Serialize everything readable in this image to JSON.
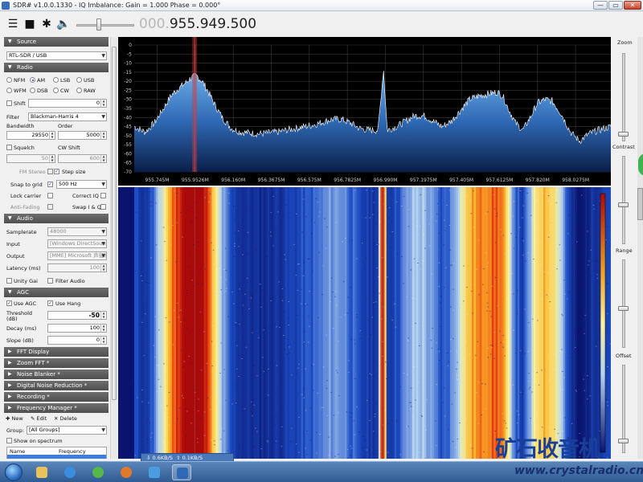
{
  "window": {
    "title": "SDR# v1.0.0.1330 - IQ Imbalance: Gain = 1.000 Phase = 0.000°",
    "minimize_label": "—",
    "maximize_label": "▭",
    "close_label": "✕"
  },
  "toolbar": {
    "menu_icon": "menu-icon",
    "stop_icon": "stop-icon",
    "settings_icon": "gear-icon",
    "volume_icon": "speaker-icon",
    "frequency_prefix": "000.",
    "frequency_value": "955.949.500"
  },
  "source": {
    "header": "Source",
    "device": "RTL-SDR / USB"
  },
  "radio": {
    "header": "Radio",
    "modes": [
      "NFM",
      "AM",
      "LSB",
      "USB",
      "WFM",
      "DSB",
      "CW",
      "RAW"
    ],
    "selected_mode": "AM",
    "shift_label": "Shift",
    "shift_value": "0",
    "filter_label": "Filter",
    "filter_value": "Blackman-Harris 4",
    "bandwidth_label": "Bandwidth",
    "bandwidth_value": "29550",
    "order_label": "Order",
    "order_value": "5000",
    "squelch_label": "Squelch",
    "squelch_value": "50",
    "cw_shift_label": "CW Shift",
    "cw_shift_value": "600",
    "fm_stereo_label": "FM Stereo",
    "step_size_label": "Step size",
    "snap_label": "Snap to grid",
    "step_value": "500 Hz",
    "lock_carrier_label": "Lock carrier",
    "correct_iq_label": "Correct IQ",
    "anti_fading_label": "Anti-Fading",
    "swap_iq_label": "Swap I & Q"
  },
  "audio": {
    "header": "Audio",
    "samplerate_label": "Samplerate",
    "samplerate_value": "48000",
    "input_label": "Input",
    "input_value": "[Windows DirectSound] ...",
    "output_label": "Output",
    "output_value": "[MME] Microsoft 声音映射器",
    "latency_label": "Latency (ms)",
    "latency_value": "100",
    "unity_gain_label": "Unity Gai",
    "filter_audio_label": "Filter Audio"
  },
  "agc": {
    "header": "AGC",
    "use_agc_label": "Use AGC",
    "use_hang_label": "Use Hang",
    "threshold_label": "Threshold",
    "threshold_unit": "(dB)",
    "threshold_value": "-50",
    "decay_label": "Decay (ms)",
    "decay_value": "100",
    "slope_label": "Slope (dB)",
    "slope_value": "0"
  },
  "collapsed_sections": [
    "FFT Display",
    "Zoom FFT *",
    "Noise Blanker *",
    "Digital Noise Reduction *",
    "Recording *",
    "Frequency Manager *"
  ],
  "frequency_manager": {
    "new_label": "New",
    "edit_label": "Edit",
    "delete_label": "Delete",
    "group_label": "Group:",
    "group_value": "[All Groups]",
    "show_spectrum_label": "Show on spectrum",
    "col_name": "Name",
    "col_frequency": "Frequency"
  },
  "right_panel": {
    "zoom_label": "Zoom",
    "contrast_label": "Contrast",
    "range_label": "Range",
    "offset_label": "Offset"
  },
  "network": {
    "down": "0.6KB/S",
    "up": "0.1KB/S"
  },
  "watermark": {
    "chinese": "矿石收音机",
    "url": "www.crystalradio.cn"
  },
  "chart_data": {
    "type": "area",
    "ylim": [
      -70,
      0
    ],
    "y_ticks": [
      0,
      -5,
      -10,
      -15,
      -20,
      -25,
      -30,
      -35,
      -40,
      -45,
      -50,
      -55,
      -60,
      -65,
      -70
    ],
    "x_tick_labels": [
      "955.745M",
      "955.9526M",
      "956.160M",
      "956.3675M",
      "956.575M",
      "956.7825M",
      "956.990M",
      "957.1975M",
      "957.405M",
      "957.6125M",
      "957.820M",
      "958.0275M"
    ],
    "x_ticks_mhz": [
      955.745,
      955.9526,
      956.16,
      956.3675,
      956.575,
      956.7825,
      956.99,
      957.1975,
      957.405,
      957.6125,
      957.82,
      958.0275
    ],
    "xlim": [
      955.62,
      958.22
    ],
    "tuned_mhz": 955.9495,
    "profile_x_mhz": [
      955.62,
      955.68,
      955.73,
      955.78,
      955.82,
      955.86,
      955.9,
      955.93,
      955.96,
      955.99,
      956.02,
      956.06,
      956.1,
      956.15,
      956.2,
      956.3,
      956.4,
      956.5,
      956.6,
      956.7,
      956.75,
      956.8,
      956.85,
      956.9,
      956.95,
      956.98,
      957.0,
      957.05,
      957.1,
      957.15,
      957.2,
      957.25,
      957.3,
      957.35,
      957.4,
      957.45,
      957.5,
      957.55,
      957.6,
      957.63,
      957.66,
      957.7,
      957.74,
      957.78,
      957.82,
      957.86,
      957.9,
      957.95,
      958.0,
      958.05,
      958.1,
      958.15,
      958.22
    ],
    "profile_y_db": [
      -45,
      -48,
      -43,
      -35,
      -28,
      -24,
      -21,
      -18,
      -17,
      -20,
      -25,
      -33,
      -40,
      -46,
      -48,
      -49,
      -48,
      -46,
      -44,
      -41,
      -41,
      -43,
      -46,
      -47,
      -47,
      -13,
      -47,
      -45,
      -42,
      -39,
      -39,
      -42,
      -45,
      -42,
      -36,
      -30,
      -28,
      -27,
      -26,
      -28,
      -35,
      -43,
      -47,
      -40,
      -32,
      -30,
      -31,
      -38,
      -48,
      -53,
      -49,
      -47,
      -45
    ],
    "grid": true
  }
}
